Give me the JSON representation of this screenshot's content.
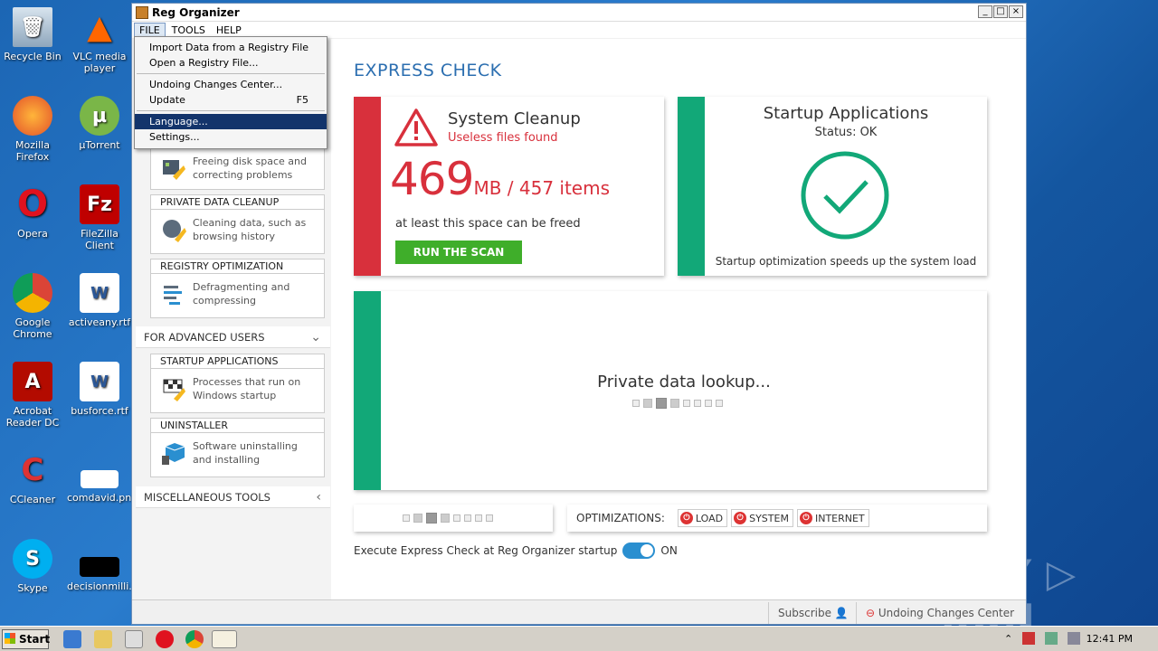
{
  "desktop": {
    "icons": [
      {
        "label": "Recycle Bin"
      },
      {
        "label": "VLC media player"
      },
      {
        "label": "Mozilla Firefox"
      },
      {
        "label": "µTorrent"
      },
      {
        "label": "Opera"
      },
      {
        "label": "FileZilla Client"
      },
      {
        "label": "Google Chrome"
      },
      {
        "label": "activeany.rtf"
      },
      {
        "label": "Acrobat Reader DC"
      },
      {
        "label": "busforce.rtf"
      },
      {
        "label": "CCleaner"
      },
      {
        "label": "comdavid.png"
      },
      {
        "label": "Skype"
      },
      {
        "label": "decisionmilli..."
      }
    ],
    "watermark": "ANY ▷ RUN"
  },
  "window": {
    "title": "Reg Organizer",
    "controls": {
      "minimize": "_",
      "maximize": "□",
      "close": "×"
    },
    "menu": [
      "FILE",
      "TOOLS",
      "HELP"
    ]
  },
  "file_menu": {
    "items": [
      {
        "label": "Import Data from a Registry File",
        "shortcut": ""
      },
      {
        "label": "Open a Registry File...",
        "shortcut": ""
      },
      {
        "label": "Undoing Changes Center...",
        "shortcut": ""
      },
      {
        "label": "Update",
        "shortcut": "F5"
      },
      {
        "label": "Language...",
        "shortcut": ""
      },
      {
        "label": "Settings...",
        "shortcut": ""
      }
    ]
  },
  "sidebar": {
    "groups": [
      {
        "head": "",
        "desc1": "Freeing disk space and",
        "desc2": "correcting problems"
      },
      {
        "head": "PRIVATE DATA CLEANUP",
        "desc1": "Cleaning data, such as",
        "desc2": "browsing history"
      },
      {
        "head": "REGISTRY OPTIMIZATION",
        "desc1": "Defragmenting and",
        "desc2": "compressing"
      },
      {
        "head": "STARTUP APPLICATIONS",
        "desc1": "Processes that run on",
        "desc2": "Windows startup"
      },
      {
        "head": "UNINSTALLER",
        "desc1": "Software uninstalling",
        "desc2": "and installing"
      }
    ],
    "sections": {
      "advanced": "FOR ADVANCED USERS",
      "misc": "MISCELLANEOUS TOOLS"
    }
  },
  "main": {
    "title": "EXPRESS CHECK",
    "cleanup": {
      "title": "System Cleanup",
      "subtitle": "Useless files found",
      "size": "469",
      "size_rest": "MB / 457 items",
      "note": "at least this space can be freed",
      "button": "RUN THE SCAN"
    },
    "startup": {
      "title": "Startup Applications",
      "status": "Status: OK",
      "note": "Startup optimization speeds up the system load"
    },
    "privacy": {
      "text": "Private data lookup..."
    },
    "optimizations": {
      "label": "OPTIMIZATIONS:",
      "items": [
        "LOAD",
        "SYSTEM",
        "INTERNET"
      ]
    },
    "startup_toggle": {
      "label": "Execute Express Check at Reg Organizer startup",
      "state": "ON"
    }
  },
  "statusbar": {
    "subscribe": "Subscribe",
    "undo": "Undoing Changes Center"
  },
  "taskbar": {
    "start": "Start",
    "clock": "12:41 PM"
  },
  "colors": {
    "red": "#d8303c",
    "green": "#12a878",
    "blue_title": "#2b6eb0",
    "button_green": "#3fae2a"
  }
}
